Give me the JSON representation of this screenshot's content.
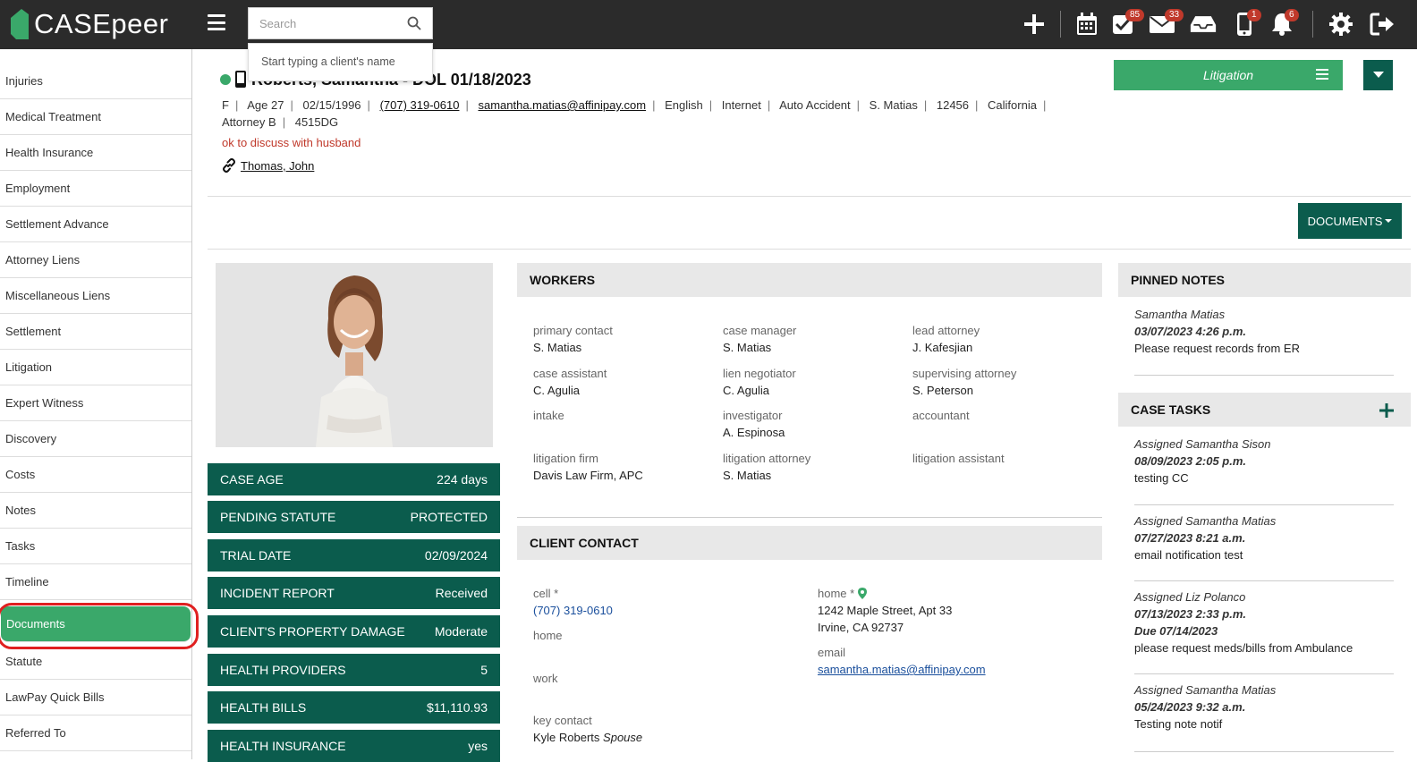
{
  "app": {
    "name": "CASEpeer"
  },
  "search": {
    "placeholder": "Search",
    "dropdown_hint": "Start typing a client's name"
  },
  "toolbar": {
    "badges": {
      "tasks": "85",
      "mail": "33",
      "phone": "1",
      "notifications": "6"
    },
    "icons": [
      "plus-icon",
      "calendar-icon",
      "tasks-icon",
      "mail-icon",
      "inbox-icon",
      "phone-icon",
      "bell-icon",
      "gear-icon",
      "logout-icon"
    ]
  },
  "sidebar": {
    "items": [
      {
        "label": "Injuries"
      },
      {
        "label": "Medical Treatment"
      },
      {
        "label": "Health Insurance"
      },
      {
        "label": "Employment"
      },
      {
        "label": "Settlement Advance"
      },
      {
        "label": "Attorney Liens"
      },
      {
        "label": "Miscellaneous Liens"
      },
      {
        "label": "Settlement"
      },
      {
        "label": "Litigation"
      },
      {
        "label": "Expert Witness"
      },
      {
        "label": "Discovery"
      },
      {
        "label": "Costs"
      },
      {
        "label": "Notes"
      },
      {
        "label": "Tasks"
      },
      {
        "label": "Timeline"
      },
      {
        "label": "Documents"
      },
      {
        "label": "Statute"
      },
      {
        "label": "LawPay Quick Bills"
      },
      {
        "label": "Referred To"
      }
    ],
    "active": "Documents"
  },
  "case": {
    "title": "Roberts, Samantha - DOL 01/18/2023",
    "gender": "F",
    "age": "Age 27",
    "dob": "02/15/1996",
    "phone": "(707) 319-0610",
    "email": "samantha.matias@affinipay.com",
    "language": "English",
    "source": "Internet",
    "case_type": "Auto Accident",
    "worker": "S. Matias",
    "number": "12456",
    "state": "California",
    "attorney": "Attorney B",
    "code": "4515DG",
    "note": "ok to discuss with husband",
    "linked": "Thomas, John",
    "stage": "Litigation",
    "documents_button": "DOCUMENTS"
  },
  "stats": [
    {
      "label": "CASE AGE",
      "value": "224 days"
    },
    {
      "label": "PENDING STATUTE",
      "value": "PROTECTED"
    },
    {
      "label": "TRIAL DATE",
      "value": "02/09/2024"
    },
    {
      "label": "INCIDENT REPORT",
      "value": "Received"
    },
    {
      "label": "CLIENT'S PROPERTY DAMAGE",
      "value": "Moderate"
    },
    {
      "label": "HEALTH PROVIDERS",
      "value": "5"
    },
    {
      "label": "HEALTH BILLS",
      "value": "$11,110.93"
    },
    {
      "label": "HEALTH INSURANCE",
      "value": "yes"
    }
  ],
  "workers": {
    "title": "WORKERS",
    "items": [
      {
        "label": "primary contact",
        "value": "S. Matias"
      },
      {
        "label": "case manager",
        "value": "S. Matias"
      },
      {
        "label": "lead attorney",
        "value": "J. Kafesjian"
      },
      {
        "label": "case assistant",
        "value": "C. Agulia"
      },
      {
        "label": "lien negotiator",
        "value": "C. Agulia"
      },
      {
        "label": "supervising attorney",
        "value": "S. Peterson"
      },
      {
        "label": "intake",
        "value": ""
      },
      {
        "label": "investigator",
        "value": "A. Espinosa"
      },
      {
        "label": "accountant",
        "value": ""
      },
      {
        "label": "litigation firm",
        "value": "Davis Law Firm, APC"
      },
      {
        "label": "litigation attorney",
        "value": "S. Matias"
      },
      {
        "label": "litigation assistant",
        "value": ""
      }
    ]
  },
  "client_contact": {
    "title": "CLIENT CONTACT",
    "cell_label": "cell *",
    "cell_value": "(707) 319-0610",
    "home_label_left": "home",
    "work_label": "work",
    "key_contact_label": "key contact",
    "key_contact_name": "Kyle Roberts",
    "key_contact_relation": "Spouse",
    "home_label": "home *",
    "address_line1": "1242 Maple Street, Apt 33",
    "address_line2": "Irvine, CA 92737",
    "email_label": "email",
    "email_value": "samantha.matias@affinipay.com"
  },
  "pinned_notes": {
    "title": "PINNED NOTES",
    "items": [
      {
        "author": "Samantha Matias",
        "date": "03/07/2023 4:26 p.m.",
        "text": "Please request records from ER"
      }
    ]
  },
  "case_tasks": {
    "title": "CASE TASKS",
    "items": [
      {
        "assigned": "Assigned Samantha Sison",
        "date": "08/09/2023 2:05 p.m.",
        "due": "",
        "text": "testing CC"
      },
      {
        "assigned": "Assigned Samantha Matias",
        "date": "07/27/2023 8:21 a.m.",
        "due": "",
        "text": "email notification test"
      },
      {
        "assigned": "Assigned Liz Polanco",
        "date": "07/13/2023 2:33 p.m.",
        "due": "Due 07/14/2023",
        "text": "please request meds/bills from Ambulance"
      },
      {
        "assigned": "Assigned Samantha Matias",
        "date": "05/24/2023 9:32 a.m.",
        "due": "",
        "text": "Testing note notif"
      }
    ]
  },
  "colors": {
    "brand_green": "#3aa86a",
    "dark_teal": "#0b5c4d",
    "topbar": "#2b2b2b",
    "badge_red": "#c0392b",
    "highlight_ring": "#e02020"
  }
}
